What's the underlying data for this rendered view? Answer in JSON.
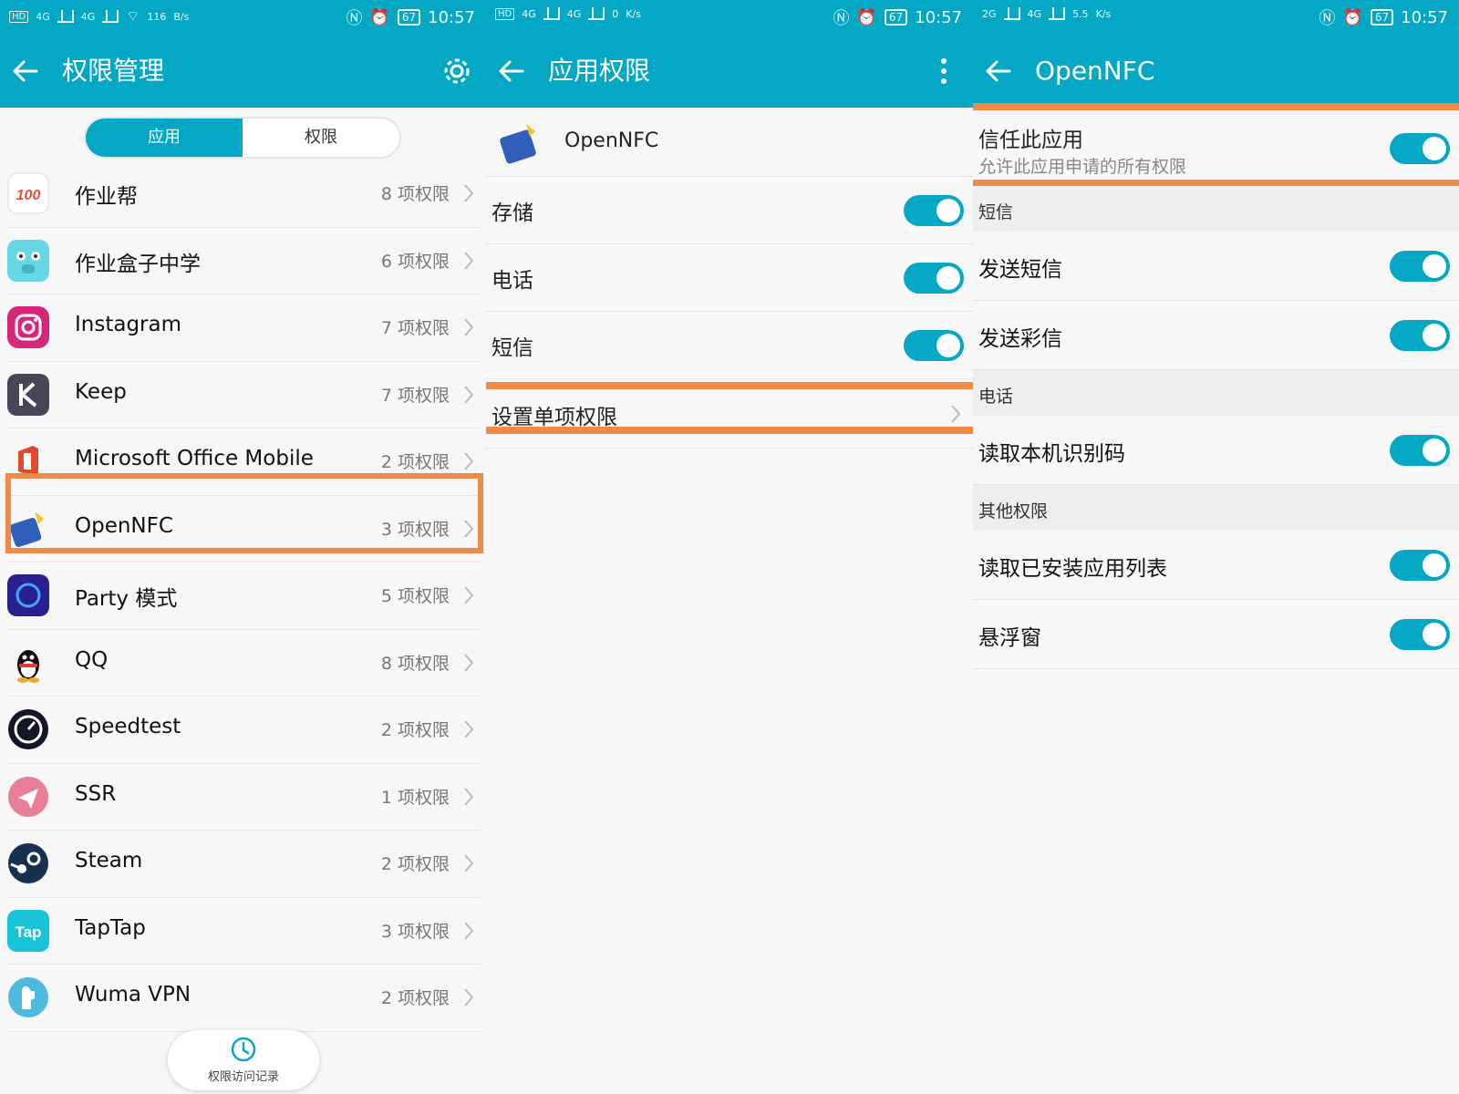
{
  "status_bar": {
    "left": [
      {
        "hd": "HD",
        "net1": "4G",
        "net2": "4G",
        "speed_value": "116",
        "speed_unit": "B/s"
      },
      {
        "hd": "HD",
        "net1": "4G",
        "net2": "4G",
        "speed_value": "0",
        "speed_unit": "K/s"
      },
      {
        "net1": "2G",
        "net2": "4G",
        "speed_value": "5.5",
        "speed_unit": "K/s"
      }
    ],
    "battery": "67",
    "time": "10:57"
  },
  "screen1": {
    "title": "权限管理",
    "tabs": [
      "应用",
      "权限"
    ],
    "apps": [
      {
        "name": "作业帮",
        "count": "8 项权限",
        "icon": "zuoyebang-icon",
        "color": "#ffffff"
      },
      {
        "name": "作业盒子中学",
        "count": "6 项权限",
        "icon": "zuoyehezi-icon",
        "color": "#67d7e6"
      },
      {
        "name": "Instagram",
        "count": "7 项权限",
        "icon": "instagram-icon",
        "color": "#d6287a"
      },
      {
        "name": "Keep",
        "count": "7 项权限",
        "icon": "keep-icon",
        "color": "#4a4458"
      },
      {
        "name": "Microsoft Office Mobile",
        "count": "2 项权限",
        "icon": "office-icon",
        "color": "#e3492b"
      },
      {
        "name": "OpenNFC",
        "count": "3 项权限",
        "icon": "opennfc-icon",
        "color": "#2f5fb8"
      },
      {
        "name": "Party 模式",
        "count": "5 项权限",
        "icon": "party-icon",
        "color": "#2a1f8f"
      },
      {
        "name": "QQ",
        "count": "8 项权限",
        "icon": "qq-icon",
        "color": "#111111"
      },
      {
        "name": "Speedtest",
        "count": "2 项权限",
        "icon": "speedtest-icon",
        "color": "#141526"
      },
      {
        "name": "SSR",
        "count": "1 项权限",
        "icon": "ssr-icon",
        "color": "#e97e98"
      },
      {
        "name": "Steam",
        "count": "2 项权限",
        "icon": "steam-icon",
        "color": "#15314f"
      },
      {
        "name": "TapTap",
        "count": "3 项权限",
        "icon": "taptap-icon",
        "color": "#19c3d8"
      },
      {
        "name": "Wuma VPN",
        "count": "2 项权限",
        "icon": "wumavpn-icon",
        "color": "#4dbbe0"
      }
    ],
    "history_label": "权限访问记录"
  },
  "screen2": {
    "title": "应用权限",
    "app_name": "OpenNFC",
    "permissions": [
      {
        "label": "存储",
        "on": true
      },
      {
        "label": "电话",
        "on": true
      },
      {
        "label": "短信",
        "on": true
      }
    ],
    "single_permission_label": "设置单项权限"
  },
  "screen3": {
    "title": "OpenNFC",
    "trust_title": "信任此应用",
    "trust_subtitle": "允许此应用申请的所有权限",
    "sections": [
      {
        "header": "短信",
        "items": [
          "发送短信",
          "发送彩信"
        ]
      },
      {
        "header": "电话",
        "items": [
          "读取本机识别码"
        ]
      },
      {
        "header": "其他权限",
        "items": [
          "读取已安装应用列表",
          "悬浮窗"
        ]
      }
    ]
  },
  "colors": {
    "accent": "#05a8c4",
    "highlight": "#f08a47"
  }
}
